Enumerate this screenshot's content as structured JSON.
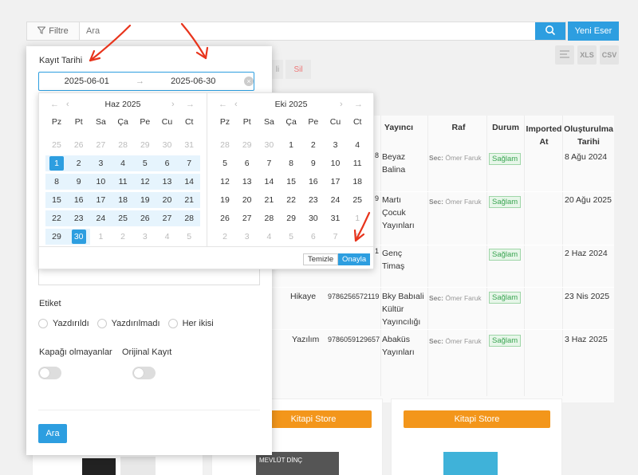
{
  "topbar": {
    "filter_label": "Filtre",
    "search_placeholder": "Ara",
    "new_label": "Yeni Eser"
  },
  "tools": {
    "xls": "XLS",
    "csv": "CSV"
  },
  "partial": {
    "sil": "Sil",
    "li": "li"
  },
  "table": {
    "headers": {
      "yayinci": "Yayıncı",
      "raf": "Raf",
      "durum": "Durum",
      "imported": "Imported At",
      "created": "Oluşturulma Tarihi"
    },
    "rows": [
      {
        "yayinci": "Beyaz Balina",
        "sec": "Sec:",
        "person": "Ömer Faruk",
        "durum": "Sağlam",
        "created": "8 Ağu 2024",
        "digit": "8"
      },
      {
        "yayinci": "Martı Çocuk Yayınları",
        "sec": "Sec:",
        "person": "Ömer Faruk",
        "durum": "Sağlam",
        "created": "20 Ağu 2025",
        "digit": "9"
      },
      {
        "yayinci": "Genç Timaş",
        "sec": "",
        "person": "",
        "durum": "Sağlam",
        "created": "2 Haz 2024",
        "digit": "1"
      },
      {
        "category": "Hikaye",
        "isbn": "9786256572119",
        "yayinci": "Bky Babıali Kültür Yayıncılığı",
        "sec": "Sec:",
        "person": "Ömer Faruk",
        "durum": "Sağlam",
        "created": "23 Nis 2025"
      },
      {
        "category": "Yazılım",
        "isbn": "9786059129657",
        "yayinci": "Abaküs Yayınları",
        "sec": "Sec:",
        "person": "Ömer Faruk",
        "durum": "Sağlam",
        "created": "3 Haz 2025"
      }
    ]
  },
  "cards": {
    "store1": "Kitapi Store",
    "store2": "Kitapi Store",
    "book_author": "MEVLÜT DİNÇ"
  },
  "panel": {
    "kayit_label": "Kayıt Tarihi",
    "date_from": "2025-06-01",
    "date_to": "2025-06-30",
    "etiket_label": "Etiket",
    "radios": [
      "Yazdırıldı",
      "Yazdırılmadı",
      "Her ikisi"
    ],
    "kapak_label": "Kapağı olmayanlar",
    "orijinal_label": "Orijinal Kayıt",
    "search_button": "Ara"
  },
  "calendar": {
    "weekdays": [
      "Pz",
      "Pt",
      "Sa",
      "Ça",
      "Pe",
      "Cu",
      "Ct"
    ],
    "left": {
      "title": "Haz 2025",
      "days": [
        [
          "25",
          "26",
          "27",
          "28",
          "29",
          "30",
          "31"
        ],
        [
          "1",
          "2",
          "3",
          "4",
          "5",
          "6",
          "7"
        ],
        [
          "8",
          "9",
          "10",
          "11",
          "12",
          "13",
          "14"
        ],
        [
          "15",
          "16",
          "17",
          "18",
          "19",
          "20",
          "21"
        ],
        [
          "22",
          "23",
          "24",
          "25",
          "26",
          "27",
          "28"
        ],
        [
          "29",
          "30",
          "1",
          "2",
          "3",
          "4",
          "5"
        ]
      ]
    },
    "right": {
      "title": "Eki 2025",
      "days": [
        [
          "28",
          "29",
          "30",
          "1",
          "2",
          "3",
          "4"
        ],
        [
          "5",
          "6",
          "7",
          "8",
          "9",
          "10",
          "11"
        ],
        [
          "12",
          "13",
          "14",
          "15",
          "16",
          "17",
          "18"
        ],
        [
          "19",
          "20",
          "21",
          "22",
          "23",
          "24",
          "25"
        ],
        [
          "26",
          "27",
          "28",
          "29",
          "30",
          "31",
          "1"
        ],
        [
          "2",
          "3",
          "4",
          "5",
          "6",
          "7",
          "8"
        ]
      ]
    },
    "clear_label": "Temizle",
    "ok_label": "Onayla"
  },
  "colors": {
    "primary": "#2d9ee0",
    "store": "#f3961b",
    "annotation": "#e8341c"
  }
}
